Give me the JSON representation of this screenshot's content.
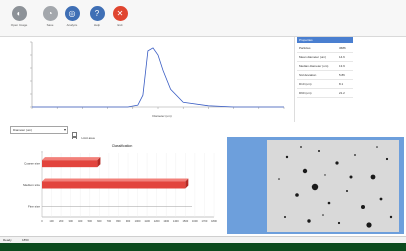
{
  "toolbar": {
    "buttons": [
      {
        "name": "open-button",
        "label": "Open Image",
        "icon": "open-icon",
        "color": "#8d9298"
      },
      {
        "name": "save-button",
        "label": "Save",
        "icon": "save-icon",
        "color": "#a3a7ac"
      },
      {
        "name": "analyze-button",
        "label": "Analyze",
        "icon": "analyze-icon",
        "color": "#3f6fb5"
      },
      {
        "name": "help-button",
        "label": "Help",
        "icon": "help-icon",
        "color": "#3f6fb5"
      },
      {
        "name": "exit-button",
        "label": "Exit",
        "icon": "exit-icon",
        "color": "#e0452f"
      }
    ]
  },
  "histogram": {
    "xlabel": "Diameter (um)"
  },
  "properties": {
    "header": "Properties",
    "rows": [
      {
        "label": "Particles",
        "value": "3686"
      },
      {
        "label": "Mean diameter (um)",
        "value": "14.6"
      },
      {
        "label": "Median diameter (um)",
        "value": "13.9"
      },
      {
        "label": "Std deviation",
        "value": "5.86"
      },
      {
        "label": "D10 (um)",
        "value": "8.1"
      },
      {
        "label": "D90 (um)",
        "value": "21.2"
      }
    ]
  },
  "selector": {
    "value": "Diameter (um)",
    "options": [
      "Limit area",
      "Show limits"
    ]
  },
  "bar_chart": {
    "title": "Classification",
    "categories": [
      "Coarse size",
      "Medium size",
      "Fine size"
    ],
    "values": [
      580,
      1500,
      0
    ],
    "xmax": 1800,
    "ticks": [
      "0",
      "100",
      "200",
      "300",
      "400",
      "500",
      "600",
      "700",
      "800",
      "900",
      "1000",
      "1100",
      "1200",
      "1300",
      "1400",
      "1500",
      "1600",
      "1700",
      "1800"
    ],
    "bar_color": "#e2443d"
  },
  "image_panel": {
    "bg_color": "#6d9fdc"
  },
  "statusbar": {
    "text": "Ready",
    "value": "1850",
    "bar_color": "#0b4a1d"
  },
  "chart_data": {
    "type": "line",
    "xlabel": "Diameter (um)",
    "x": [
      0,
      10,
      20,
      30,
      38,
      42,
      44,
      46,
      48,
      50,
      52,
      55,
      60,
      70,
      80,
      100
    ],
    "series": [
      {
        "values": [
          0,
          0,
          0,
          0,
          0,
          3,
          20,
          95,
          100,
          88,
          62,
          30,
          8,
          2,
          0,
          0
        ]
      }
    ],
    "ylim": [
      0,
      110
    ]
  }
}
